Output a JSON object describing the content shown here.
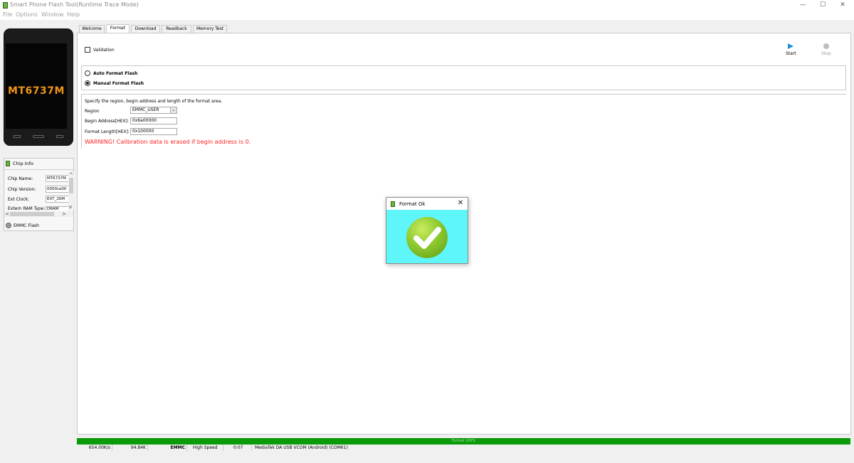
{
  "window": {
    "title": "Smart Phone Flash Tool(Runtime Trace Mode)",
    "minimize_glyph": "—",
    "maximize_glyph": "☐",
    "close_glyph": "✕"
  },
  "menu": [
    "File",
    "Options",
    "Window",
    "Help"
  ],
  "phone": {
    "model": "MT6737M"
  },
  "chip_info": {
    "header": "Chip Info",
    "rows": [
      {
        "label": "Chip Name:",
        "value": "MT6737M"
      },
      {
        "label": "Chip Version:",
        "value": "0000ca00"
      },
      {
        "label": "Ext Clock:",
        "value": "EXT_26M"
      },
      {
        "label": "Extern RAM Type:",
        "value": "DRAM"
      }
    ],
    "up_arrow": "^",
    "down_arrow": "v",
    "left_arrow": "<",
    "right_arrow": ">",
    "storage_label": "EMMC Flash"
  },
  "tabs": [
    "Welcome",
    "Format",
    "Download",
    "Readback",
    "Memory Test"
  ],
  "active_tab": "Format",
  "format": {
    "validation_label": "Validation",
    "validation_checked": false,
    "start_label": "Start",
    "stop_label": "Stop",
    "auto_label": "Auto Format Flash",
    "manual_label": "Manual Format Flash",
    "selected_mode": "manual",
    "instructions": "Specify the region, begin address and length of the format area.",
    "region_label": "Region",
    "region_value": "EMMC_USER",
    "begin_label": "Begin Address[HEX]:",
    "begin_value": "0x6a00000",
    "length_label": "Format Length[HEX]:",
    "length_value": "0x100000",
    "warning": "WARNING! Calibration data is erased if begin address is 0."
  },
  "dialog": {
    "title": "Format Ok",
    "close_glyph": "✕"
  },
  "progress": {
    "text": "Format 100%",
    "percent": 100
  },
  "status": {
    "speed": "654.00K/s",
    "size": "94.84K",
    "storage": "EMMC",
    "mode": "High Speed",
    "time": "0:07",
    "port": "MediaTek DA USB VCOM (Android) (COM61)"
  },
  "colors": {
    "progress": "#0a9a0a",
    "dialog_background": "#5ff6fa",
    "warning": "#ff2020",
    "chip_model": "#f0951a",
    "start_icon": "#1e8fd8"
  },
  "icons": {
    "app": "flash-tool-icon",
    "start": "play-icon",
    "stop": "stop-icon",
    "dialog_check": "checkmark-icon",
    "emmc": "gear-icon"
  }
}
